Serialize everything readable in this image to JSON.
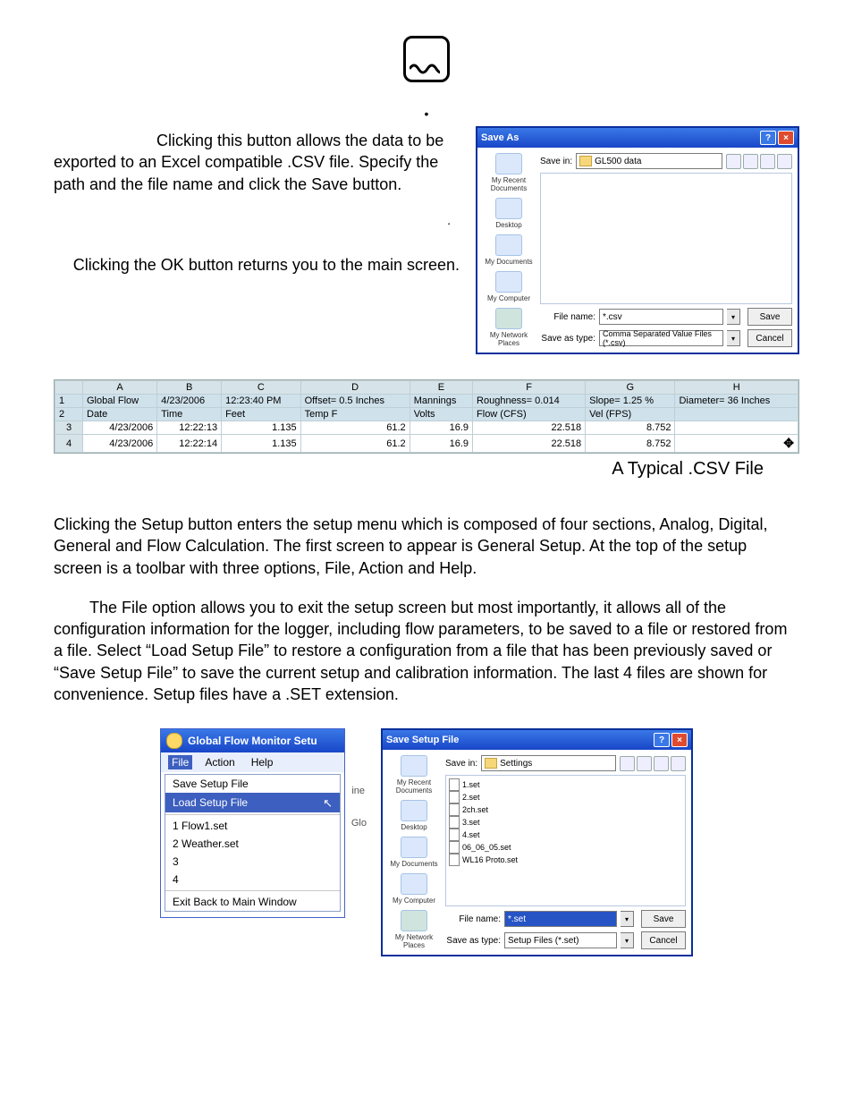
{
  "logo_alt": "Global Water logo",
  "bullet_row": "•",
  "para1_a": "Clicking this button",
  "para1_b": "allows the data to be exported to an Excel compatible .CSV file. Specify the path and the file name and click the Save button.",
  "bullet_row2": ".",
  "para2": "Clicking the OK button returns you to the main screen.",
  "saveas": {
    "title": "Save As",
    "save_in_label": "Save in:",
    "save_in_value": "GL500 data",
    "places": [
      "My Recent Documents",
      "Desktop",
      "My Documents",
      "My Computer",
      "My Network Places"
    ],
    "file_name_label": "File name:",
    "file_name_value": "*.csv",
    "save_as_type_label": "Save as type:",
    "save_as_type_value": "Comma Separated Value Files (*.csv)",
    "btn_save": "Save",
    "btn_cancel": "Cancel"
  },
  "csv": {
    "cols": [
      "A",
      "B",
      "C",
      "D",
      "E",
      "F",
      "G",
      "H"
    ],
    "row1": [
      "Global Flow",
      "4/23/2006",
      "12:23:40 PM",
      "Offset= 0.5 Inches",
      "Mannings",
      "Roughness= 0.014",
      "Slope= 1.25 %",
      "Diameter= 36 Inches"
    ],
    "row2": [
      "Date",
      "Time",
      "Feet",
      "Temp F",
      "Volts",
      "Flow (CFS)",
      "Vel (FPS)",
      ""
    ],
    "rows": [
      [
        "4/23/2006",
        "12:22:13",
        "1.135",
        "61.2",
        "16.9",
        "22.518",
        "8.752",
        ""
      ],
      [
        "4/23/2006",
        "12:22:14",
        "1.135",
        "61.2",
        "16.9",
        "22.518",
        "8.752",
        ""
      ]
    ],
    "caption": "A Typical .CSV File"
  },
  "para3": "Clicking the Setup button enters the setup menu which is composed of four sections, Analog, Digital, General and Flow Calculation.  The first screen to appear is General Setup.  At the top of the setup screen is a toolbar with three options, File, Action and Help.",
  "para4": "The File option allows you to exit the setup screen but most importantly, it allows all of the configuration information for the logger, including flow parameters, to be saved to a file or restored from a file.  Select “Load Setup File” to restore a configuration from a file that has been previously saved or “Save Setup File” to save the current setup and calibration information.  The last 4 files are shown for convenience.  Setup files have a .SET extension.",
  "setupmenu": {
    "title": "Global Flow Monitor Setu",
    "menu": [
      "File",
      "Action",
      "Help"
    ],
    "items_top": [
      "Save Setup File",
      "Load Setup File"
    ],
    "items_files": [
      "1 Flow1.set",
      "2 Weather.set",
      "3",
      "4"
    ],
    "item_exit": "Exit Back to Main Window",
    "edge1": "ine",
    "edge2": "Glo"
  },
  "savesetup": {
    "title": "Save Setup File",
    "save_in_label": "Save in:",
    "save_in_value": "Settings",
    "places": [
      "My Recent Documents",
      "Desktop",
      "My Documents",
      "My Computer",
      "My Network Places"
    ],
    "files": [
      "1.set",
      "2.set",
      "2ch.set",
      "3.set",
      "4.set",
      "06_06_05.set",
      "WL16 Proto.set"
    ],
    "file_name_label": "File name:",
    "file_name_value": "*.set",
    "save_as_type_label": "Save as type:",
    "save_as_type_value": "Setup Files (*.set)",
    "btn_save": "Save",
    "btn_cancel": "Cancel"
  }
}
